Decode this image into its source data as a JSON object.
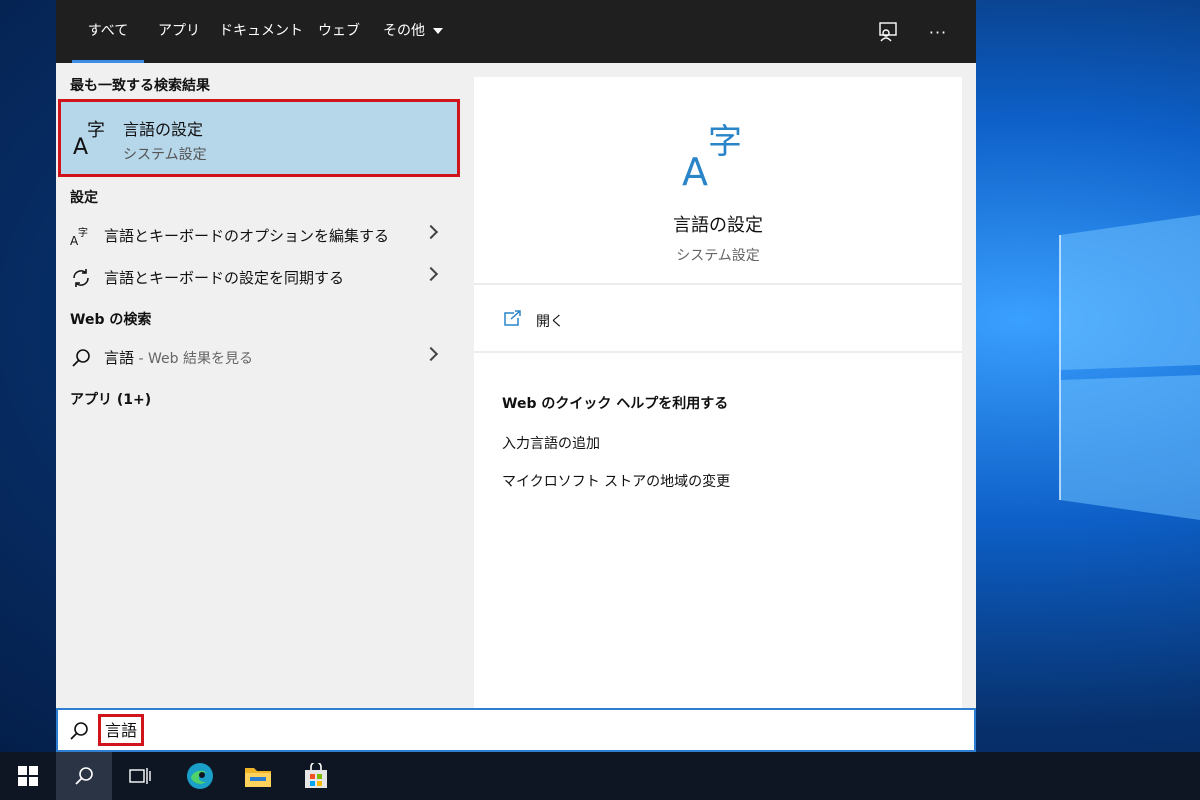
{
  "tabs": [
    {
      "label": "すべて",
      "active": true
    },
    {
      "label": "アプリ"
    },
    {
      "label": "ドキュメント"
    },
    {
      "label": "ウェブ"
    },
    {
      "label": "その他"
    }
  ],
  "top_icons": [
    "feedback-icon",
    "more-icon"
  ],
  "more_label": "···",
  "best_match": {
    "heading": "最も一致する検索結果",
    "title": "言語の設定",
    "subtitle": "システム設定",
    "icon": "language-icon"
  },
  "settings_section": {
    "heading": "設定",
    "items": [
      {
        "label": "言語とキーボードのオプションを編集する",
        "icon": "language-icon"
      },
      {
        "label": "言語とキーボードの設定を同期する",
        "icon": "sync-icon"
      }
    ]
  },
  "web_section": {
    "heading": "Web の検索",
    "query": "言語",
    "suffix": " - Web 結果を見る"
  },
  "apps_section": {
    "heading": "アプリ (1+)"
  },
  "detail": {
    "title": "言語の設定",
    "subtitle": "システム設定",
    "open_label": "開く",
    "help_heading": "Web のクイック ヘルプを利用する",
    "help_links": [
      "入力言語の追加",
      "マイクロソフト ストアの地域の変更"
    ]
  },
  "search": {
    "value": "言語"
  },
  "colors": {
    "accent": "#2e7fd1",
    "highlight": "#b6d6ea",
    "callout": "#d0141b",
    "topbar": "#1f1f1f"
  },
  "taskbar": [
    "windows-icon",
    "search-icon",
    "task-view-icon",
    "edge-icon",
    "file-explorer-icon",
    "store-icon"
  ]
}
